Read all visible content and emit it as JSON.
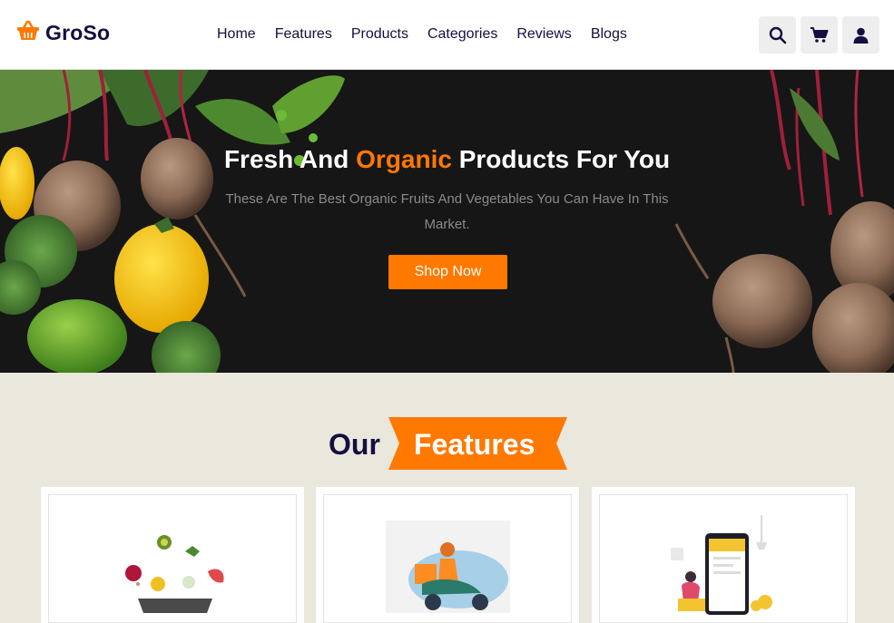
{
  "brand": {
    "name": "GroSo",
    "accent": "#ff7800",
    "dark": "#130f40"
  },
  "nav": {
    "items": [
      "Home",
      "Features",
      "Products",
      "Categories",
      "Reviews",
      "Blogs"
    ]
  },
  "header_icons": [
    "search-icon",
    "cart-icon",
    "user-icon"
  ],
  "hero": {
    "title_start": "Fresh And ",
    "title_accent": "Organic",
    "title_end": " Products For You",
    "subtitle": "These Are The Best Organic Fruits And Vegetables You Can Have In This Market.",
    "button": "Shop Now"
  },
  "features": {
    "heading_dark": "Our",
    "heading_highlight": "Features",
    "cards": [
      {
        "illustration": "vegetable-bowl-illustration"
      },
      {
        "illustration": "delivery-scooter-illustration"
      },
      {
        "illustration": "mobile-payment-illustration"
      }
    ]
  }
}
